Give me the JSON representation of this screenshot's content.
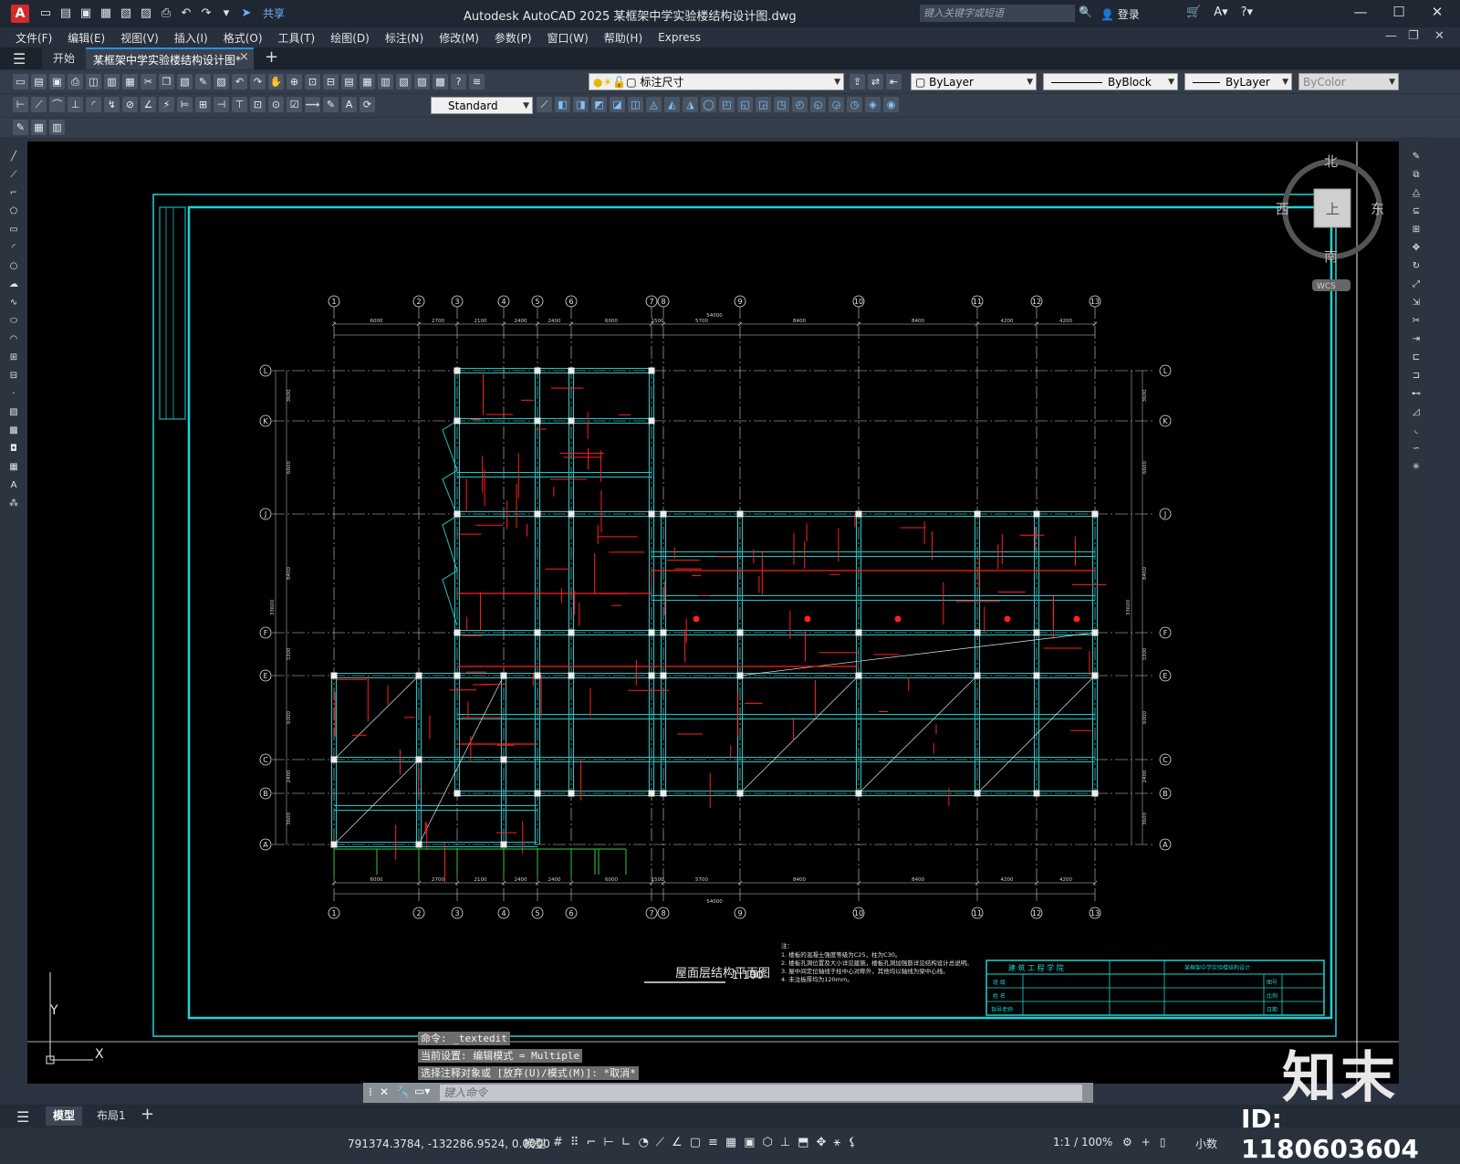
{
  "app": {
    "logo": "A",
    "title": "Autodesk AutoCAD 2025    某框架中学实验楼结构设计图.dwg",
    "share": "共享",
    "search_placeholder": "键入关键字或短语",
    "login": "登录"
  },
  "menu": [
    "文件(F)",
    "编辑(E)",
    "视图(V)",
    "插入(I)",
    "格式(O)",
    "工具(T)",
    "绘图(D)",
    "标注(N)",
    "修改(M)",
    "参数(P)",
    "窗口(W)",
    "帮助(H)",
    "Express"
  ],
  "tabs": {
    "start": "开始",
    "file": "某框架中学实验楼结构设计图*",
    "close": "×",
    "plus": "+"
  },
  "toolbar": {
    "dimstyle_layer": "标注尺寸",
    "color": "ByLayer",
    "linetype": "ByBlock",
    "lineweight": "ByLayer",
    "plotstyle": "ByColor",
    "textstyle": "Standard"
  },
  "viewcube": {
    "north": "北",
    "south": "南",
    "east": "东",
    "west": "西",
    "top": "上",
    "wcs": "WCS"
  },
  "drawing": {
    "grid_cols": [
      "1",
      "2",
      "3",
      "4",
      "5",
      "6",
      "7",
      "8",
      "9",
      "10",
      "11",
      "12",
      "13"
    ],
    "grid_rows": [
      "L",
      "K",
      "J",
      "F",
      "E",
      "C",
      "B",
      "A"
    ],
    "top_dims": [
      "6000",
      "2700",
      "2100",
      "2400",
      "2400",
      "6000",
      "1500",
      "5700",
      "8400",
      "8400",
      "4200",
      "4200"
    ],
    "bottom_dims": [
      "6000",
      "2700",
      "2100",
      "2400",
      "2400",
      "6000",
      "1500",
      "5700",
      "8400",
      "8400",
      "4200",
      "4200"
    ],
    "total_dim": "54000",
    "left_dims": [
      "3600",
      "6600",
      "8400",
      "3300",
      "6000",
      "2400",
      "3600"
    ],
    "total_left": "33600",
    "plan_title": "屋面层结构平面图",
    "plan_scale": "1:100",
    "notes": [
      "注：",
      "1. 楼板的混凝土强度等级为C25，柱为C30。",
      "2. 楼板孔洞位置及大小详见建施，楼板孔洞加强筋详见结构设计总说明。",
      "3. 屋中间定位轴线于柱中心对称外，其他均以轴线为梁中心线。",
      "4. 未注板厚均为120mm。"
    ],
    "titleblock": {
      "school": "建 筑 工 程 学 院",
      "project": "某框架中学实验楼结构设计",
      "row_labels": [
        "班 级",
        "姓 名",
        "指导老师"
      ],
      "right_labels": [
        "图号",
        "比例",
        "日期"
      ]
    }
  },
  "command": {
    "line1": "命令: _textedit",
    "line2": "当前设置: 编辑模式 = Multiple",
    "line3": "选择注释对象或 [放弃(U)/模式(M)]: *取消*",
    "placeholder": "键入命令"
  },
  "layout_tabs": [
    "模型",
    "布局1"
  ],
  "status": {
    "coords": "791374.3784, -132286.9524, 0.0000",
    "model": "模型",
    "scale": "1:1 / 100%",
    "units": "小数"
  },
  "watermark": {
    "brand": "知末",
    "id": "ID: 1180603604"
  },
  "colors": {
    "grid": "#ffffff",
    "beam": "#1ec8c8",
    "rebar": "#ff2020",
    "frame": "#1ad6d6",
    "dim": "#cfcfcf"
  }
}
